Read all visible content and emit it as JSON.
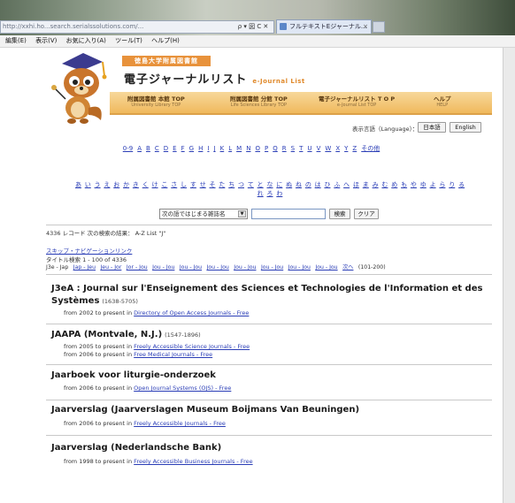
{
  "browser": {
    "address": "http://xxhi.ho...search.serialssolutions.com/...",
    "address_controls": "ρ ▾ 図 C ✕",
    "tab_title": "フルテキストEジャーナル...",
    "tab_close": "×",
    "menu": [
      "編集(E)",
      "表示(V)",
      "お気に入り(A)",
      "ツール(T)",
      "ヘルプ(H)"
    ]
  },
  "header": {
    "library_badge": "徳島大学附属図書館",
    "site_title": "電子ジャーナルリスト",
    "site_title_en": "e-Journal List"
  },
  "nav": [
    {
      "label": "附属図書館 本館 TOP",
      "sub": "University Library TOP"
    },
    {
      "label": "附属図書館 分館 TOP",
      "sub": "Life Sciences Library TOP"
    },
    {
      "label": "電子ジャーナルリスト T O P",
      "sub": "e-Journal List TOP"
    },
    {
      "label": "ヘルプ",
      "sub": "HELP"
    }
  ],
  "language": {
    "label": "表示言語（Language）：",
    "japanese": "日本語",
    "english": "English"
  },
  "alpha_index": [
    "0-9",
    "A",
    "B",
    "C",
    "D",
    "E",
    "F",
    "G",
    "H",
    "I",
    "J",
    "K",
    "L",
    "M",
    "N",
    "O",
    "P",
    "Q",
    "R",
    "S",
    "T",
    "U",
    "V",
    "W",
    "X",
    "Y",
    "Z",
    "その他"
  ],
  "kana_index_line1": [
    "あ",
    "い",
    "う",
    "え",
    "お",
    "か",
    "き",
    "く",
    "け",
    "こ",
    "さ",
    "し",
    "す",
    "せ",
    "そ",
    "た",
    "ち",
    "つ",
    "て",
    "と",
    "な",
    "に",
    "ぬ",
    "ね",
    "の",
    "は",
    "ひ",
    "ふ",
    "へ",
    "ほ",
    "ま",
    "み",
    "む",
    "め",
    "も",
    "や",
    "ゆ",
    "よ",
    "ら",
    "り",
    "る"
  ],
  "kana_index_line2": [
    "れ",
    "ろ",
    "わ"
  ],
  "search": {
    "mode": "次の語ではじまる雑誌名",
    "arrow": "▼",
    "query": "",
    "search_button": "検索",
    "clear_button": "クリア"
  },
  "records_info": "4336 レコード 次の検索の結果： A-Z List \"J\"",
  "skip_link": "スキップ・ナビゲーションリンク",
  "title_search_info": "タイトル検索 1 - 100 of 4336",
  "paging": {
    "current": "J3e - Jap",
    "links": [
      "Jap - Jeu",
      "Jeu - Jor",
      "Jor - Jou",
      "Jou - Jou",
      "Jou - Jou",
      "Jou - Jou",
      "Jou - Jou",
      "Jou - Jou",
      "Jou - Jou",
      "Jou - Jou"
    ],
    "next_link": "次へ",
    "next_range": "(101-200)"
  },
  "results": [
    {
      "title_line1": "J3eA : Journal sur l'Enseignement des Sciences et Technologies de l'Information et des",
      "title_line2": "Systèmes",
      "issn": "(1638-5705)",
      "coverage": [
        {
          "text": "from 2002 to present in",
          "source": "Directory of Open Access Journals - Free"
        }
      ]
    },
    {
      "title": "JAAPA (Montvale, N.J.)",
      "issn": "(1547-1896)",
      "coverage": [
        {
          "text": "from 2005 to present in",
          "source": "Freely Accessible Science Journals - Free"
        },
        {
          "text": "from 2006 to present in",
          "source": "Free Medical Journals - Free"
        }
      ]
    },
    {
      "title": "Jaarboek voor liturgie-onderzoek",
      "coverage": [
        {
          "text": "from 2006 to present in",
          "source": "Open Journal Systems (OJS) - Free"
        }
      ]
    },
    {
      "title": "Jaarverslag (Jaarverslagen Museum Boijmans Van Beuningen)",
      "coverage": [
        {
          "text": "from 2006 to present in",
          "source": "Freely Accessible Journals - Free"
        }
      ]
    },
    {
      "title": "Jaarverslag (Nederlandsche Bank)",
      "coverage": [
        {
          "text": "from 1998 to present in",
          "source": "Freely Accessible Business Journals - Free"
        }
      ]
    }
  ]
}
